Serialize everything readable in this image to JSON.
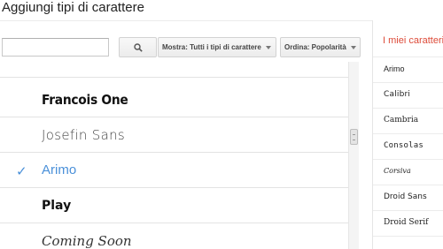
{
  "page": {
    "title": "Aggiungi tipi di carattere"
  },
  "search": {
    "placeholder": "",
    "value": ""
  },
  "toolbar": {
    "filter_label": "Mostra: Tutti i tipi di carattere",
    "sort_label": "Ordina: Popolarità"
  },
  "font_list": {
    "items": [
      {
        "name": "Francois One",
        "selected": false
      },
      {
        "name": "Josefin Sans",
        "selected": false
      },
      {
        "name": "Arimo",
        "selected": true
      },
      {
        "name": "Play",
        "selected": false
      },
      {
        "name": "Coming Soon",
        "selected": false
      }
    ],
    "check_glyph": "✓"
  },
  "my_fonts": {
    "heading": "I miei caratteri",
    "items": [
      "Arimo",
      "Calibri",
      "Cambria",
      "Consolas",
      "Corsiva",
      "Droid Sans",
      "Droid Serif"
    ]
  },
  "colors": {
    "accent_blue": "#4a90d9",
    "heading_red": "#dd4b39"
  },
  "icons": {
    "search": "search-icon",
    "dropdown": "chevron-down-icon",
    "check": "check-icon"
  }
}
